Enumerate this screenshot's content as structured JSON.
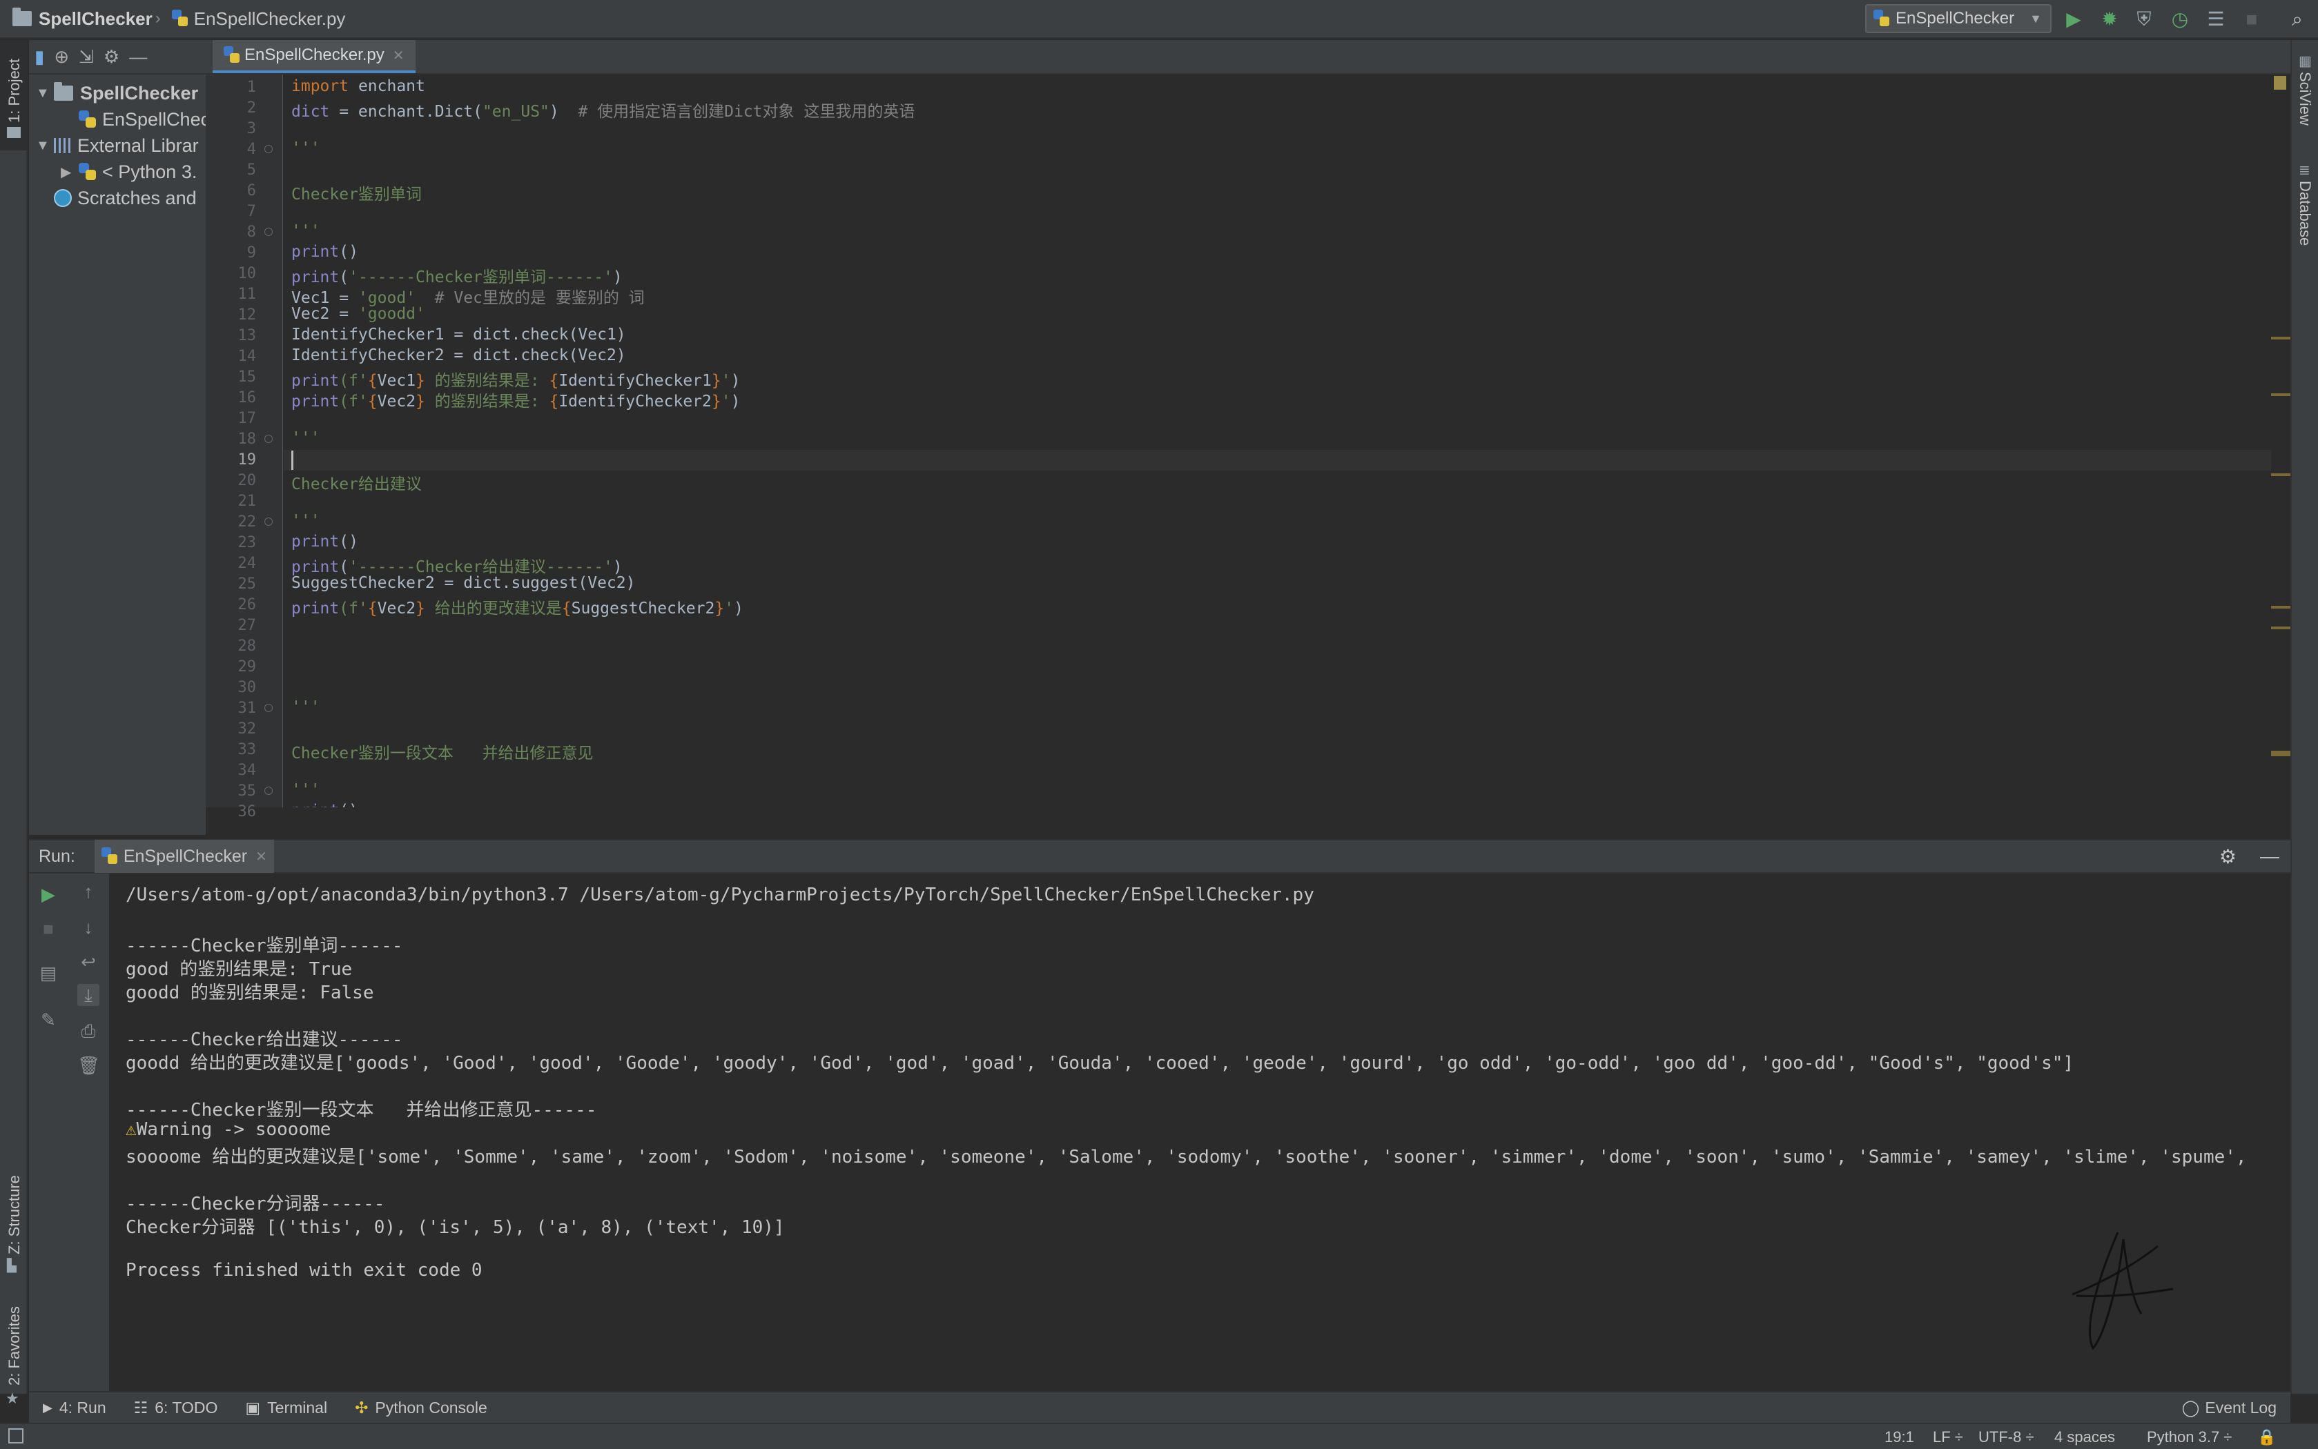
{
  "navbar": {
    "project": "SpellChecker",
    "file": "EnSpellChecker.py",
    "run_config": "EnSpellChecker"
  },
  "left_strip": {
    "project_tab": "1: Project",
    "structure_tab": "Z: Structure",
    "favorites_tab": "2: Favorites"
  },
  "right_strip": {
    "sciview_tab": "SciView",
    "database_tab": "Database"
  },
  "project_tree": [
    {
      "label": "SpellChecker",
      "arrow": "▼",
      "icon": "folder-icon",
      "indent": 0
    },
    {
      "label": "EnSpellChec",
      "arrow": "",
      "icon": "python-file-icon",
      "indent": 1
    },
    {
      "label": "External Librar",
      "arrow": "▼",
      "icon": "library-icon",
      "indent": 0
    },
    {
      "label": "< Python 3.",
      "arrow": "▶",
      "icon": "python-sdk-icon",
      "indent": 1
    },
    {
      "label": "Scratches and",
      "arrow": "",
      "icon": "scratches-icon",
      "indent": 0
    }
  ],
  "editor": {
    "tab_label": "EnSpellChecker.py",
    "current_line": 19,
    "lines": [
      [
        {
          "t": "import ",
          "c": "kw"
        },
        {
          "t": "enchant",
          "c": ""
        }
      ],
      [
        {
          "t": "dict",
          "c": "bi"
        },
        {
          "t": " = enchant.Dict(",
          "c": ""
        },
        {
          "t": "\"en_US\"",
          "c": "st"
        },
        {
          "t": ")  ",
          "c": ""
        },
        {
          "t": "# 使用指定语言创建Dict对象 这里我用的英语",
          "c": "cm"
        }
      ],
      [],
      [
        {
          "t": "'''",
          "c": "st"
        }
      ],
      [],
      [
        {
          "t": "Checker鉴别单词",
          "c": "st"
        }
      ],
      [],
      [
        {
          "t": "'''",
          "c": "st"
        }
      ],
      [
        {
          "t": "print",
          "c": "bi"
        },
        {
          "t": "()",
          "c": ""
        }
      ],
      [
        {
          "t": "print",
          "c": "bi"
        },
        {
          "t": "(",
          "c": ""
        },
        {
          "t": "'------Checker鉴别单词------'",
          "c": "st"
        },
        {
          "t": ")",
          "c": ""
        }
      ],
      [
        {
          "t": "Vec1 = ",
          "c": ""
        },
        {
          "t": "'good'",
          "c": "st"
        },
        {
          "t": "  ",
          "c": ""
        },
        {
          "t": "# Vec里放的是 要鉴别的 词",
          "c": "cm"
        }
      ],
      [
        {
          "t": "Vec2 = ",
          "c": ""
        },
        {
          "t": "'goodd'",
          "c": "st"
        }
      ],
      [
        {
          "t": "IdentifyChecker1 = dict.check(Vec1)",
          "c": ""
        }
      ],
      [
        {
          "t": "IdentifyChecker2 = dict.check(Vec2)",
          "c": ""
        }
      ],
      [
        {
          "t": "print",
          "c": "bi"
        },
        {
          "t": "(f'",
          "c": "st"
        },
        {
          "t": "{",
          "c": "fs"
        },
        {
          "t": "Vec1",
          "c": ""
        },
        {
          "t": "}",
          "c": "fs"
        },
        {
          "t": " 的鉴别结果是: ",
          "c": "st"
        },
        {
          "t": "{",
          "c": "fs"
        },
        {
          "t": "IdentifyChecker1",
          "c": ""
        },
        {
          "t": "}",
          "c": "fs"
        },
        {
          "t": "'",
          "c": "st"
        },
        {
          "t": ")",
          "c": ""
        }
      ],
      [
        {
          "t": "print",
          "c": "bi"
        },
        {
          "t": "(f'",
          "c": "st"
        },
        {
          "t": "{",
          "c": "fs"
        },
        {
          "t": "Vec2",
          "c": ""
        },
        {
          "t": "}",
          "c": "fs"
        },
        {
          "t": " 的鉴别结果是: ",
          "c": "st"
        },
        {
          "t": "{",
          "c": "fs"
        },
        {
          "t": "IdentifyChecker2",
          "c": ""
        },
        {
          "t": "}",
          "c": "fs"
        },
        {
          "t": "'",
          "c": "st"
        },
        {
          "t": ")",
          "c": ""
        }
      ],
      [],
      [
        {
          "t": "'''",
          "c": "st"
        }
      ],
      [],
      [
        {
          "t": "Checker给出建议",
          "c": "st"
        }
      ],
      [],
      [
        {
          "t": "'''",
          "c": "st"
        }
      ],
      [
        {
          "t": "print",
          "c": "bi"
        },
        {
          "t": "()",
          "c": ""
        }
      ],
      [
        {
          "t": "print",
          "c": "bi"
        },
        {
          "t": "(",
          "c": ""
        },
        {
          "t": "'------Checker给出建议------'",
          "c": "st"
        },
        {
          "t": ")",
          "c": ""
        }
      ],
      [
        {
          "t": "SuggestChecker2 = dict.suggest(Vec2)",
          "c": ""
        }
      ],
      [
        {
          "t": "print",
          "c": "bi"
        },
        {
          "t": "(f'",
          "c": "st"
        },
        {
          "t": "{",
          "c": "fs"
        },
        {
          "t": "Vec2",
          "c": ""
        },
        {
          "t": "}",
          "c": "fs"
        },
        {
          "t": " 给出的更改建议是",
          "c": "st"
        },
        {
          "t": "{",
          "c": "fs"
        },
        {
          "t": "SuggestChecker2",
          "c": ""
        },
        {
          "t": "}",
          "c": "fs"
        },
        {
          "t": "'",
          "c": "st"
        },
        {
          "t": ")",
          "c": ""
        }
      ],
      [],
      [],
      [],
      [],
      [
        {
          "t": "'''",
          "c": "st"
        }
      ],
      [],
      [
        {
          "t": "Checker鉴别一段文本   并给出修正意见",
          "c": "st"
        }
      ],
      [],
      [
        {
          "t": "'''",
          "c": "st"
        }
      ],
      [
        {
          "t": "print",
          "c": "bi"
        },
        {
          "t": "()",
          "c": ""
        }
      ]
    ]
  },
  "run_panel": {
    "label": "Run:",
    "tab": "EnSpellChecker",
    "console": [
      "/Users/atom-g/opt/anaconda3/bin/python3.7 /Users/atom-g/PycharmProjects/PyTorch/SpellChecker/EnSpellChecker.py",
      "",
      "------Checker鉴别单词------",
      "good 的鉴别结果是: True",
      "goodd 的鉴别结果是: False",
      "",
      "------Checker给出建议------",
      "goodd 给出的更改建议是['goods', 'Good', 'good', 'Goode', 'goody', 'God', 'god', 'goad', 'Gouda', 'cooed', 'geode', 'gourd', 'go odd', 'go-odd', 'goo dd', 'goo-dd', \"Good's\", \"good's\"]",
      "",
      "------Checker鉴别一段文本   并给出修正意见------",
      "Warning -> soooome",
      "soooome 给出的更改建议是['some', 'Somme', 'same', 'zoom', 'Sodom', 'noisome', 'someone', 'Salome', 'sodomy', 'soothe', 'sooner', 'simmer', 'dome', 'soon', 'sumo', 'Sammie', 'samey', 'slime', 'spume',",
      "",
      "------Checker分词器------",
      "Checker分词器 [('this', 0), ('is', 5), ('a', 8), ('text', 10)]",
      "",
      "Process finished with exit code 0"
    ]
  },
  "bottom_bar": {
    "run": "4: Run",
    "todo": "6: TODO",
    "terminal": "Terminal",
    "python_console": "Python Console",
    "event_log": "Event Log"
  },
  "status_bar": {
    "position": "19:1",
    "line_sep": "LF ÷",
    "encoding": "UTF-8 ÷",
    "indent": "4 spaces",
    "interpreter": "Python 3.7 ÷"
  },
  "colors": {
    "keyword": "#cc7832",
    "string": "#6a8759",
    "comment": "#808080",
    "builtin": "#8888c6",
    "accent": "#4a88c7",
    "run_green": "#59a869"
  }
}
